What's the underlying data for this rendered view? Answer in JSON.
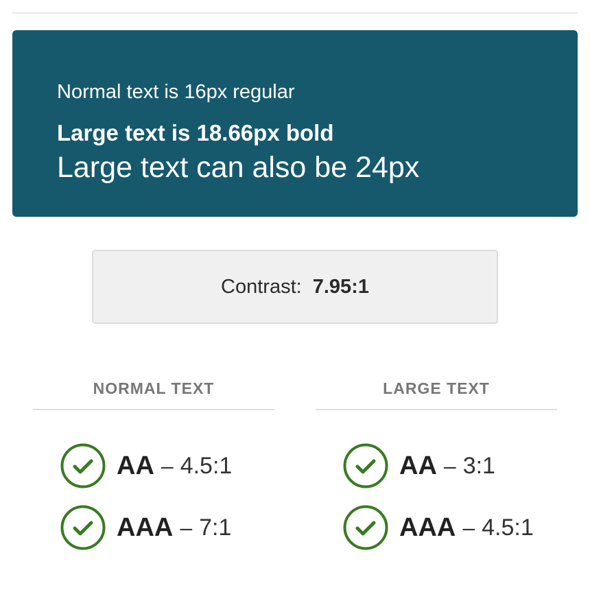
{
  "preview": {
    "normal_text": "Normal text is 16px regular",
    "large_bold_text": "Large text is 18.66px bold",
    "large_text": "Large text can also be 24px",
    "background_color": "#16596d",
    "text_color": "#ffffff"
  },
  "contrast": {
    "label": "Contrast:",
    "ratio": "7.95:1"
  },
  "results": {
    "normal": {
      "heading": "NORMAL TEXT",
      "items": [
        {
          "level": "AA",
          "separator": "–",
          "requirement": "4.5:1",
          "status": "pass",
          "icon": "check-circle-icon"
        },
        {
          "level": "AAA",
          "separator": "–",
          "requirement": "7:1",
          "status": "pass",
          "icon": "check-circle-icon"
        }
      ]
    },
    "large": {
      "heading": "LARGE TEXT",
      "items": [
        {
          "level": "AA",
          "separator": "–",
          "requirement": "3:1",
          "status": "pass",
          "icon": "check-circle-icon"
        },
        {
          "level": "AAA",
          "separator": "–",
          "requirement": "4.5:1",
          "status": "pass",
          "icon": "check-circle-icon"
        }
      ]
    },
    "pass_color": "#3a7a23"
  }
}
